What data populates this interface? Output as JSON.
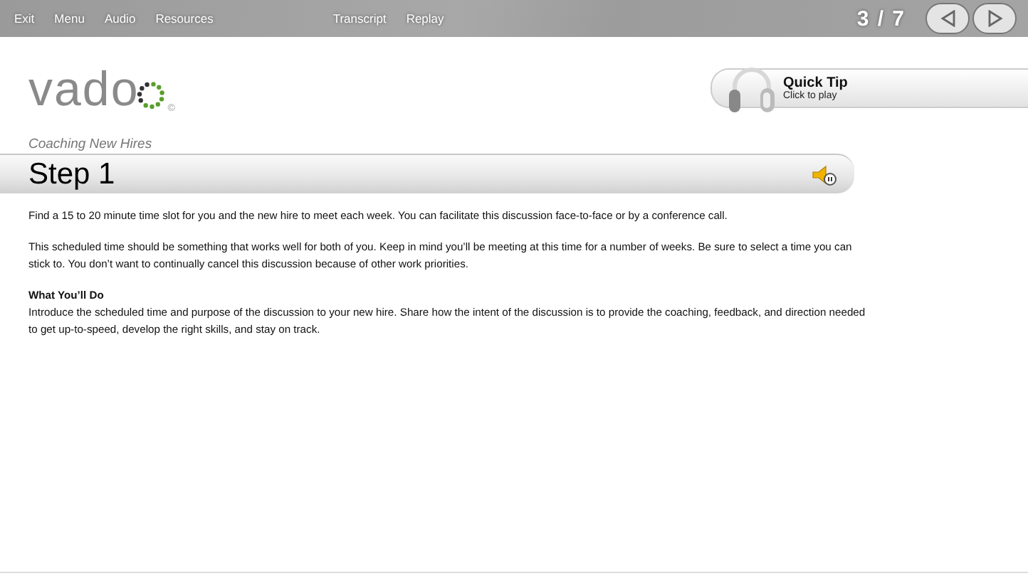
{
  "nav": {
    "left": [
      "Exit",
      "Menu",
      "Audio",
      "Resources"
    ],
    "center": [
      "Transcript",
      "Replay"
    ],
    "page_counter": "3 / 7"
  },
  "logo": {
    "text": "vado",
    "mark": "©"
  },
  "quick_tip": {
    "title": "Quick Tip",
    "subtitle": "Click to play"
  },
  "course_title": "Coaching New Hires",
  "step_title": "Step 1",
  "content": [
    {
      "kind": "paragraph",
      "text": "Find a 15 to 20 minute time slot for you and the new hire to meet each week. You can facilitate this discussion face-to-face or by a conference call."
    },
    {
      "kind": "paragraph",
      "text": "This scheduled time should be something that works well for both of you. Keep in mind you’ll be meeting at this time for a number of weeks. Be sure to select a time you can stick to. You don’t want to continually cancel this discussion because of other work priorities."
    },
    {
      "kind": "heading",
      "text": "What You’ll Do"
    },
    {
      "kind": "paragraph",
      "text": "Introduce the scheduled time and purpose of the discussion to your new hire. Share how the intent of the discussion is to provide the coaching, feedback, and direction needed to get up-to-speed, develop the right skills, and stay on track."
    }
  ]
}
